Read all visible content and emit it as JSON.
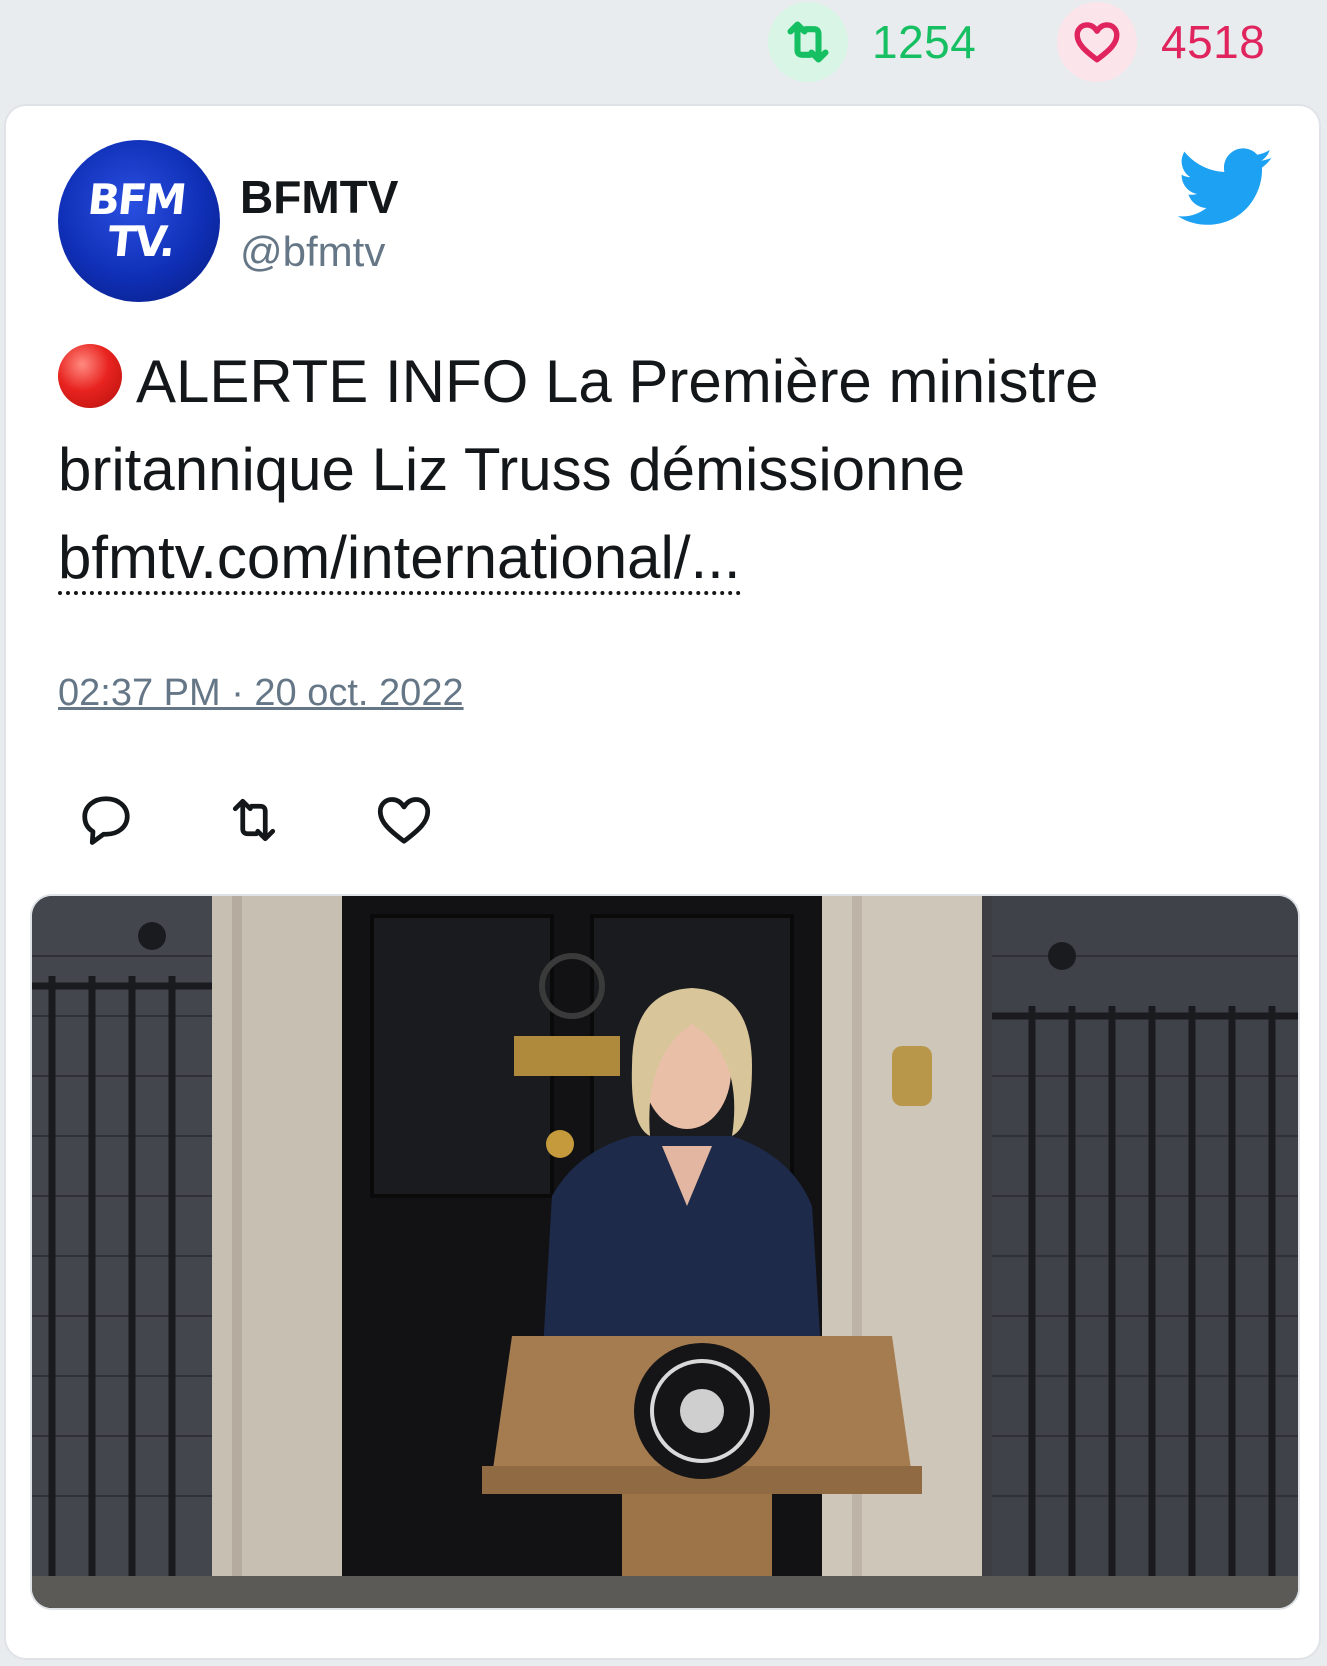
{
  "stats": {
    "retweets": "1254",
    "likes": "4518",
    "retweet_icon": "retweet-icon",
    "like_icon": "heart-icon"
  },
  "tweet": {
    "author_name": "BFMTV",
    "author_handle": "@bfmtv",
    "avatar_text_line1": "BFM",
    "avatar_text_line2": "TV.",
    "text": "ALERTE INFO La Première ministre britannique Liz Truss démissionne",
    "link": "bfmtv.com/international/...",
    "timestamp": "02:37 PM · 20 oct. 2022",
    "platform_icon": "twitter-bird-icon"
  },
  "actions": [
    "reply-icon",
    "retweet-icon",
    "like-icon"
  ],
  "colors": {
    "retweet": "#17bf63",
    "like": "#e0245e",
    "twitter_blue": "#1da1f2",
    "secondary_text": "#657786"
  }
}
